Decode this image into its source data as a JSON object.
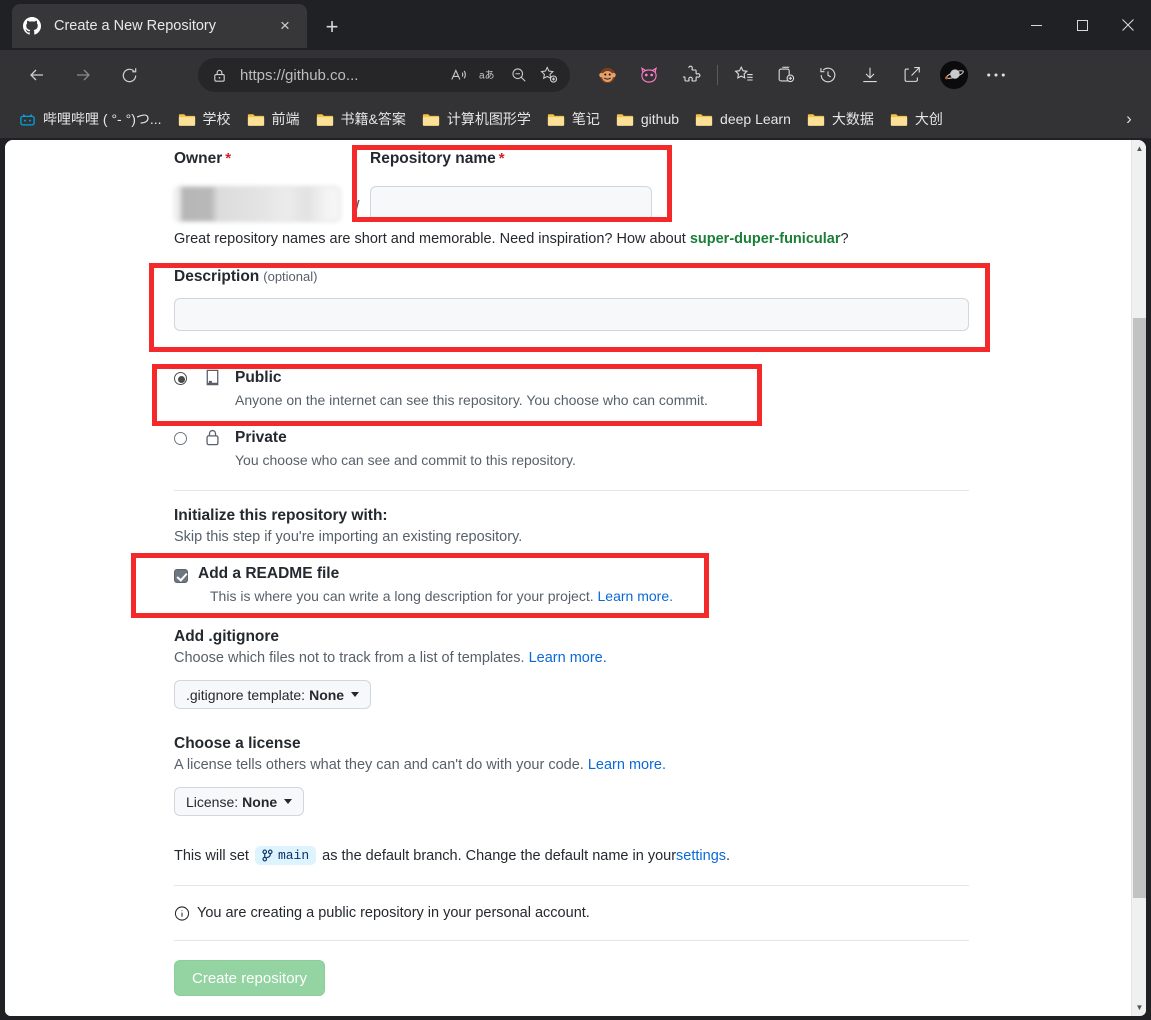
{
  "browser": {
    "tab": {
      "title": "Create a New Repository",
      "favicon": "github-icon",
      "close": "×"
    },
    "new_tab_label": "+",
    "window_controls": {
      "minimize": "minimize-icon",
      "maximize": "maximize-icon",
      "close": "close-icon"
    },
    "nav": {
      "back": "back-arrow-icon",
      "forward": "forward-arrow-icon",
      "reload": "reload-icon"
    },
    "omnibox": {
      "lock": "lock-icon",
      "url": "https://github.co...",
      "read_aloud": "read-aloud-icon",
      "translate": "translate-icon",
      "zoom_out": "zoom-out-icon",
      "add_favorite": "add-favorite-icon"
    },
    "toolbar_icons": [
      "monkey-extension-icon",
      "cat-extension-icon",
      "puzzle-extension-icon",
      "favorites-icon",
      "collections-icon",
      "history-icon",
      "downloads-icon",
      "share-icon",
      "profile-avatar-icon",
      "settings-more-icon"
    ],
    "bookmarks": [
      {
        "label": "哔哩哔哩 ( °- °)つ...",
        "icon": "bilibili-icon"
      },
      {
        "label": "学校",
        "icon": "folder-icon"
      },
      {
        "label": "前端",
        "icon": "folder-icon"
      },
      {
        "label": "书籍&答案",
        "icon": "folder-icon"
      },
      {
        "label": "计算机图形学",
        "icon": "folder-icon"
      },
      {
        "label": "笔记",
        "icon": "folder-icon"
      },
      {
        "label": "github",
        "icon": "folder-icon"
      },
      {
        "label": "deep Learn",
        "icon": "folder-icon"
      },
      {
        "label": "大数据",
        "icon": "folder-icon"
      },
      {
        "label": "大创",
        "icon": "folder-icon"
      }
    ],
    "bookmarks_overflow": "›"
  },
  "form": {
    "owner": {
      "label": "Owner",
      "required_mark": "*",
      "value": ""
    },
    "separator": "/",
    "repo_name": {
      "label": "Repository name",
      "required_mark": "*",
      "value": "",
      "placeholder": ""
    },
    "hint": {
      "prefix": "Great repository names are short and memorable. Need inspiration? How about ",
      "suggestion": "super-duper-funicular",
      "suffix": "?"
    },
    "description": {
      "label": "Description",
      "optional": "(optional)",
      "value": "",
      "placeholder": ""
    },
    "visibility": {
      "options": [
        {
          "id": "public",
          "title": "Public",
          "description": "Anyone on the internet can see this repository. You choose who can commit.",
          "icon": "book-icon",
          "selected": true
        },
        {
          "id": "private",
          "title": "Private",
          "description": "You choose who can see and commit to this repository.",
          "icon": "lock-icon",
          "selected": false
        }
      ]
    },
    "initialize": {
      "title": "Initialize this repository with:",
      "subtitle": "Skip this step if you're importing an existing repository."
    },
    "readme": {
      "title": "Add a README file",
      "description": "This is where you can write a long description for your project. ",
      "link": "Learn more.",
      "checked": true
    },
    "gitignore": {
      "title": "Add .gitignore",
      "description": "Choose which files not to track from a list of templates. ",
      "link": "Learn more.",
      "button_prefix": ".gitignore template:",
      "button_value": "None"
    },
    "license": {
      "title": "Choose a license",
      "description": "A license tells others what they can and can't do with your code. ",
      "link": "Learn more.",
      "button_prefix": "License:",
      "button_value": "None"
    },
    "branch": {
      "prefix": "This will set",
      "chip": "main",
      "middle": "as the default branch. Change the default name in your ",
      "link": "settings",
      "suffix": "."
    },
    "note": {
      "icon": "info-icon",
      "text": "You are creating a public repository in your personal account."
    },
    "submit": {
      "label": "Create repository"
    }
  },
  "colors": {
    "accent_green": "#1a7f37",
    "link_blue": "#0969da",
    "required_red": "#cf222e",
    "annotation_red": "#f42a2a",
    "button_green": "#94d3a2",
    "chip_blue_bg": "#ddf4ff"
  },
  "annotations": {
    "boxes": [
      {
        "name": "repo-name-highlight"
      },
      {
        "name": "description-highlight"
      },
      {
        "name": "public-option-highlight"
      },
      {
        "name": "readme-highlight"
      }
    ]
  }
}
